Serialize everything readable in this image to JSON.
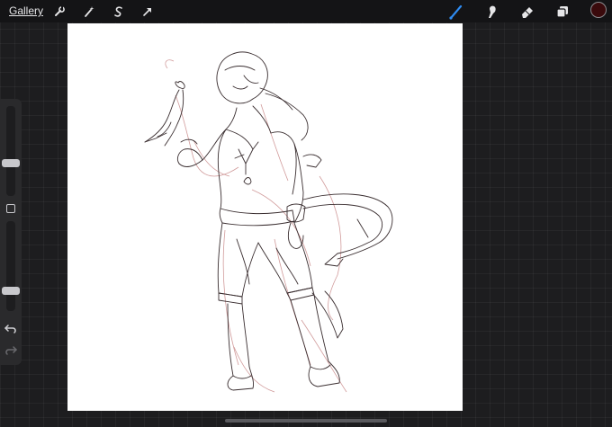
{
  "topbar": {
    "gallery_label": "Gallery",
    "left_tools": [
      {
        "name": "actions",
        "icon": "wrench-icon"
      },
      {
        "name": "adjustments",
        "icon": "magic-wand-icon"
      },
      {
        "name": "selection",
        "icon": "selection-s-icon"
      },
      {
        "name": "transform",
        "icon": "arrow-cursor-icon"
      }
    ],
    "right_tools": [
      {
        "name": "brush",
        "icon": "brush-icon",
        "active": true
      },
      {
        "name": "smudge",
        "icon": "smudge-icon",
        "active": false
      },
      {
        "name": "eraser",
        "icon": "eraser-icon",
        "active": false
      },
      {
        "name": "layers",
        "icon": "layers-icon",
        "active": false
      }
    ],
    "current_color": "#3a0a0c"
  },
  "colors": {
    "accent": "#2f8cf2",
    "sketch_line": "#3a2e30",
    "sketch_red": "#c98a8a"
  },
  "sidebar": {
    "brush_size_level": 0.35,
    "opacity_level": 0.2,
    "undo_icon": "undo-icon",
    "redo_icon": "redo-icon",
    "modify_icon": "square-modify-icon"
  },
  "canvas": {
    "content": "pencil-sketch-artwork"
  }
}
